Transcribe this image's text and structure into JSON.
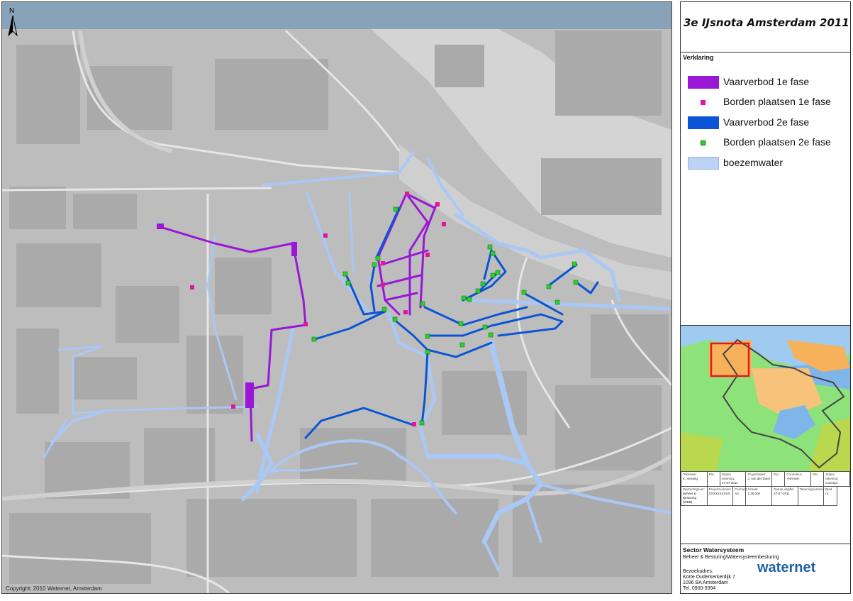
{
  "map": {
    "copyright": "Copyright:  2010 Waternet, Amsterdam",
    "north_label": "N",
    "colors": {
      "background": "#bdbdbd",
      "blocks": "#a8a8a8",
      "ij_water": "#d2d2d2",
      "boezemwater": "#a9c8f5",
      "phase1": "#9a17d6",
      "phase2": "#0a55d6",
      "sign1": "#e0179e",
      "sign2": "#2ad12a",
      "header_band": "#7f9fb8"
    }
  },
  "panel": {
    "title": "3e IJsnota Amsterdam 2011",
    "legend_heading": "Verklaring",
    "legend": [
      {
        "label": "Vaarverbod 1e fase",
        "symbol": "purple-fill",
        "color": "#9a17d6"
      },
      {
        "label": "Borden plaatsen 1e fase",
        "symbol": "magenta-square",
        "color": "#e0179e"
      },
      {
        "label": "Vaarverbod 2e fase",
        "symbol": "blue-fill",
        "color": "#0a55d6"
      },
      {
        "label": "Borden plaatsen 2e fase",
        "symbol": "green-square",
        "color": "#2ad12a"
      },
      {
        "label": "boezemwater",
        "symbol": "lightblue-fill",
        "color": "#bcd3f7"
      }
    ],
    "meta": {
      "row1": [
        {
          "head": "Tekenaar:",
          "value": "K. Vendrig"
        },
        {
          "head": "Par.",
          "value": ""
        },
        {
          "head": "Datum tekening:",
          "value": "27-07-2011"
        },
        {
          "head": "Projectleider:",
          "value": "J. van der Does"
        },
        {
          "head": "Par.",
          "value": ""
        },
        {
          "head": "Controleur:",
          "value": "<NAAM>"
        },
        {
          "head": "Par.",
          "value": ""
        },
        {
          "head": "Status tekening:",
          "value": "Concept"
        }
      ],
      "row2": [
        {
          "head": "Opdrachtgever:",
          "value": "Beheer & Besturing (WBB)"
        },
        {
          "head": "Projectnummer:",
          "value": "XXXXXXXXXX"
        },
        {
          "head": "Formaat:",
          "value": "A3"
        },
        {
          "head": "Schaal:",
          "value": "1:35.000"
        },
        {
          "head": "Datum uitgifte:",
          "value": "27-07-2011"
        },
        {
          "head": "Tekeningnummer:",
          "value": ""
        },
        {
          "head": "Blad nr:",
          "value": ""
        }
      ]
    },
    "sector": "Sector Watersysteem",
    "department": "Beheer & Besturing\\Watersysteembesturing",
    "address": [
      "Bezoekadres:",
      "Korte Ouderkerkerdijk 7",
      "1096 BA Amsterdam",
      "Tel. 0900-9394"
    ],
    "logo": "waternet"
  }
}
